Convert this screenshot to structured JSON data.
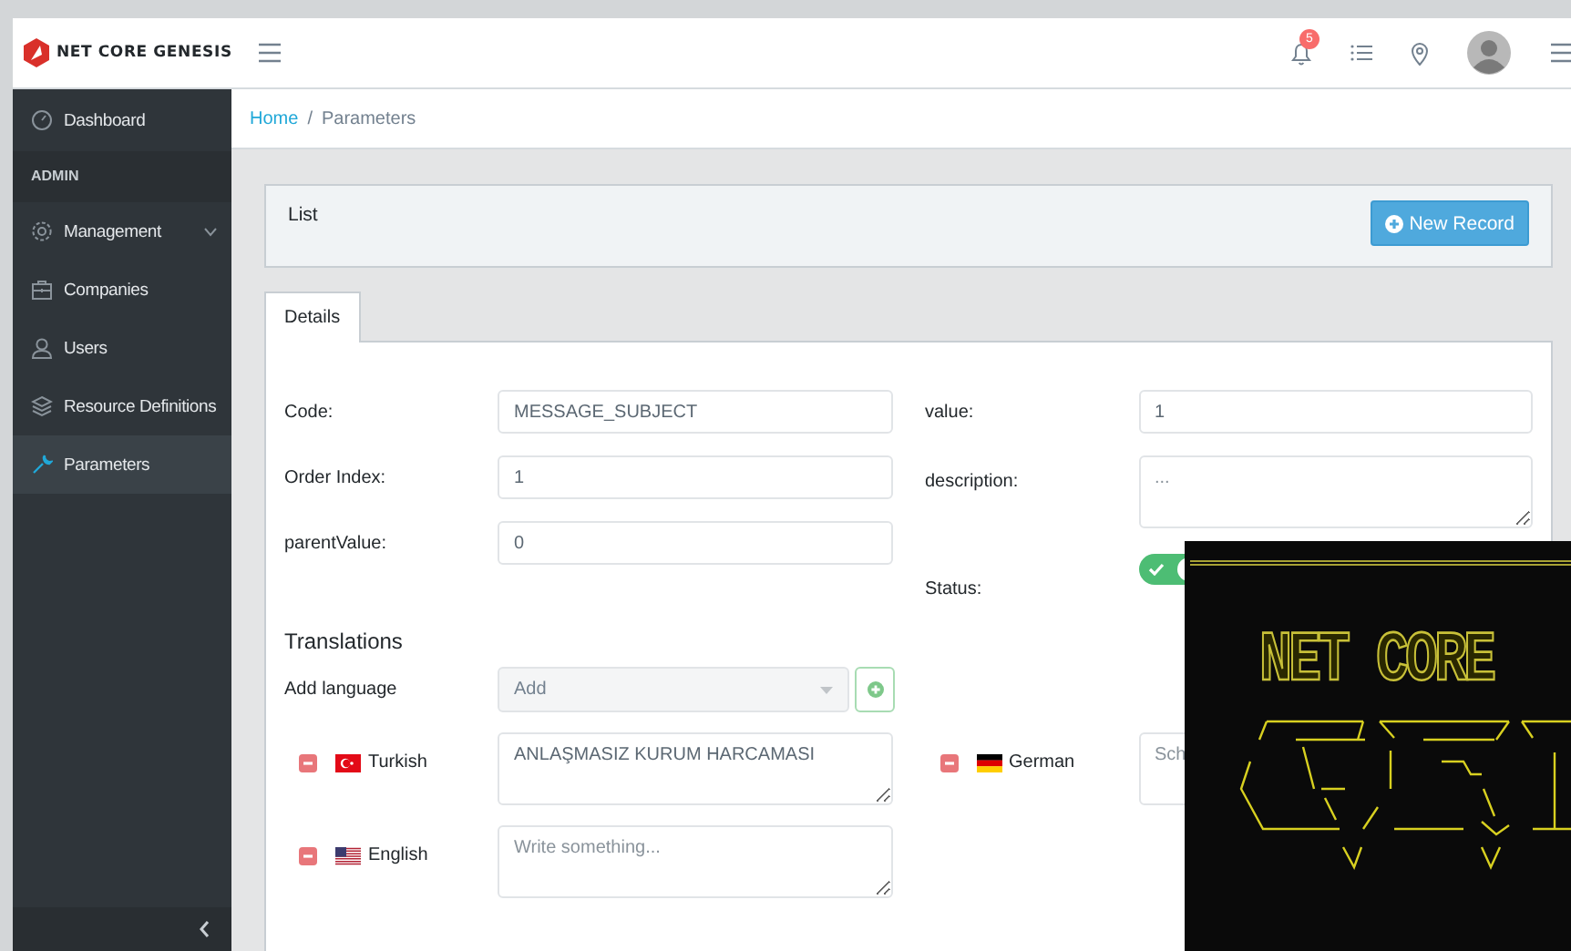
{
  "header": {
    "brand": "NET CORE GENESIS",
    "notification_count": "5"
  },
  "sidebar": {
    "items": [
      {
        "kind": "item",
        "label": "Dashboard",
        "selected": false,
        "expandable": false
      },
      {
        "kind": "section",
        "label": "ADMIN"
      },
      {
        "kind": "item",
        "label": "Management",
        "selected": false,
        "expandable": true
      },
      {
        "kind": "item",
        "label": "Companies",
        "selected": false,
        "expandable": false
      },
      {
        "kind": "item",
        "label": "Users",
        "selected": false,
        "expandable": false
      },
      {
        "kind": "item",
        "label": "Resource Definitions",
        "selected": false,
        "expandable": false
      },
      {
        "kind": "item",
        "label": "Parameters",
        "selected": true,
        "expandable": false
      }
    ]
  },
  "breadcrumb": {
    "separator": "/",
    "items": [
      "Home",
      "Parameters"
    ]
  },
  "list_card": {
    "title": "List",
    "button": "New Record"
  },
  "tabs": [
    {
      "label": "Details",
      "selected": true
    }
  ],
  "form": {
    "left_fields": [
      {
        "kind": "input",
        "label": "Code:",
        "value": "MESSAGE_SUBJECT"
      },
      {
        "kind": "input",
        "label": "Order Index:",
        "value": "1"
      },
      {
        "kind": "input",
        "label": "parentValue:",
        "value": "0"
      }
    ],
    "right_fields": [
      {
        "kind": "input",
        "label": "value:",
        "value": "1"
      },
      {
        "kind": "textarea",
        "label": "description:",
        "placeholder": "..."
      },
      {
        "kind": "toggle",
        "label": "Status:",
        "on": true
      }
    ]
  },
  "translations": {
    "title": "Translations",
    "add_label": "Add language",
    "add_select": "Add",
    "items": [
      {
        "kind": "tr",
        "language": "Turkish",
        "value": "ANLAŞMASIZ KURUM HARCAMASI"
      },
      {
        "kind": "de",
        "language": "German",
        "placeholder": "Sch"
      },
      {
        "kind": "us",
        "language": "English",
        "placeholder": "Write something..."
      }
    ]
  },
  "terminal": {
    "banner": "NET CORE"
  }
}
